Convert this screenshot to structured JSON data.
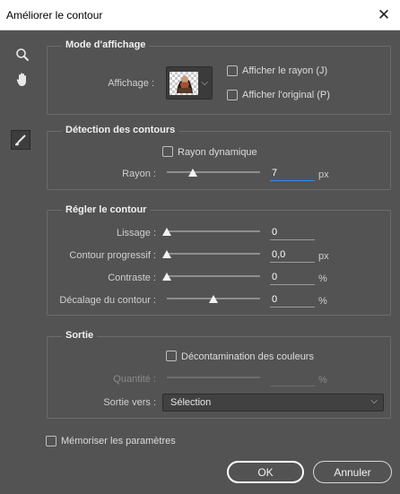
{
  "window": {
    "title": "Améliorer le contour"
  },
  "tools": [
    "zoom-icon",
    "hand-icon",
    "refine-brush-icon"
  ],
  "display_mode": {
    "section_title": "Mode d'affichage",
    "affichage_label": "Affichage :",
    "show_radius_label": "Afficher le rayon (J)",
    "show_original_label": "Afficher l'original (P)"
  },
  "edge_detection": {
    "section_title": "Détection des contours",
    "smart_radius_label": "Rayon dynamique",
    "radius_label": "Rayon :",
    "radius_value": "7",
    "radius_unit": "px",
    "radius_level": 0.28
  },
  "adjust_edge": {
    "section_title": "Régler le contour",
    "rows": [
      {
        "label": "Lissage :",
        "value": "0",
        "unit": "",
        "level": 0
      },
      {
        "label": "Contour progressif :",
        "value": "0,0",
        "unit": "px",
        "level": 0
      },
      {
        "label": "Contraste :",
        "value": "0",
        "unit": "%",
        "level": 0
      },
      {
        "label": "Décalage du contour :",
        "value": "0",
        "unit": "%",
        "level": 0.5
      }
    ]
  },
  "output": {
    "section_title": "Sortie",
    "decontaminate_label": "Décontamination des couleurs",
    "amount_label": "Quantité :",
    "amount_unit": "%",
    "output_to_label": "Sortie vers :",
    "output_to_value": "Sélection"
  },
  "remember_label": "Mémoriser les paramètres",
  "buttons": {
    "ok": "OK",
    "cancel": "Annuler"
  }
}
